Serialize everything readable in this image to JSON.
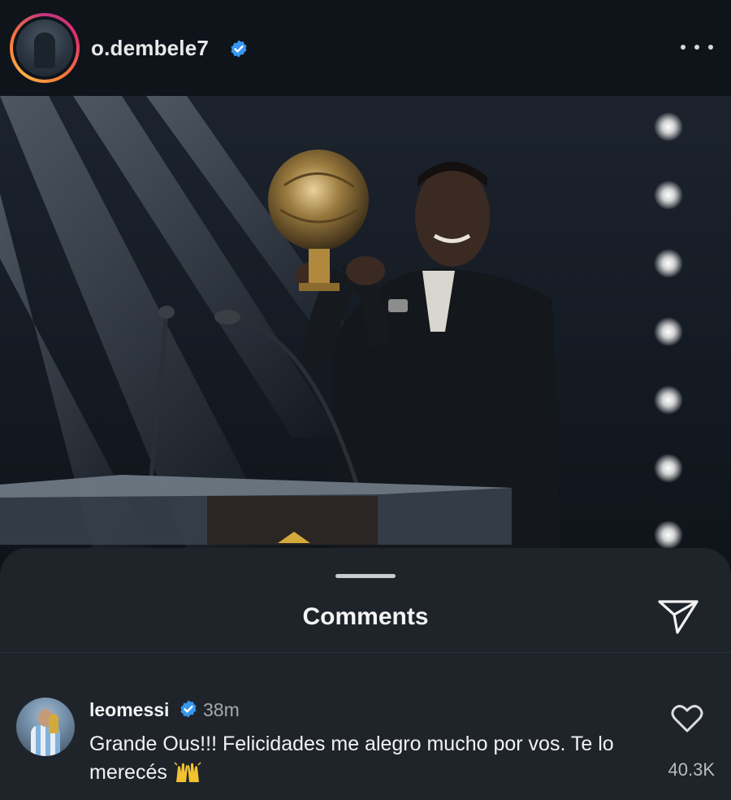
{
  "post": {
    "username": "o.dembele7",
    "verified": true,
    "avatar_icon": "profile-avatar",
    "more_icon": "more-horizontal-icon"
  },
  "photo": {
    "subject": "man in black suit holding golden ball trophy on stage behind lectern with microphones"
  },
  "comments_sheet": {
    "title": "Comments",
    "share_icon": "send-paper-plane-icon",
    "comments": [
      {
        "username": "leomessi",
        "verified": true,
        "time": "38m",
        "text": "Grande Ous!!! Felicidades me alegro mucho por vos. Te lo merecés",
        "emoji": "raising-hands",
        "like_count": "40.3K"
      }
    ]
  },
  "colors": {
    "background": "#0d1118",
    "sheet": "#1f242b",
    "verified_blue": "#3897f0",
    "muted_text": "#a5a9ae"
  }
}
